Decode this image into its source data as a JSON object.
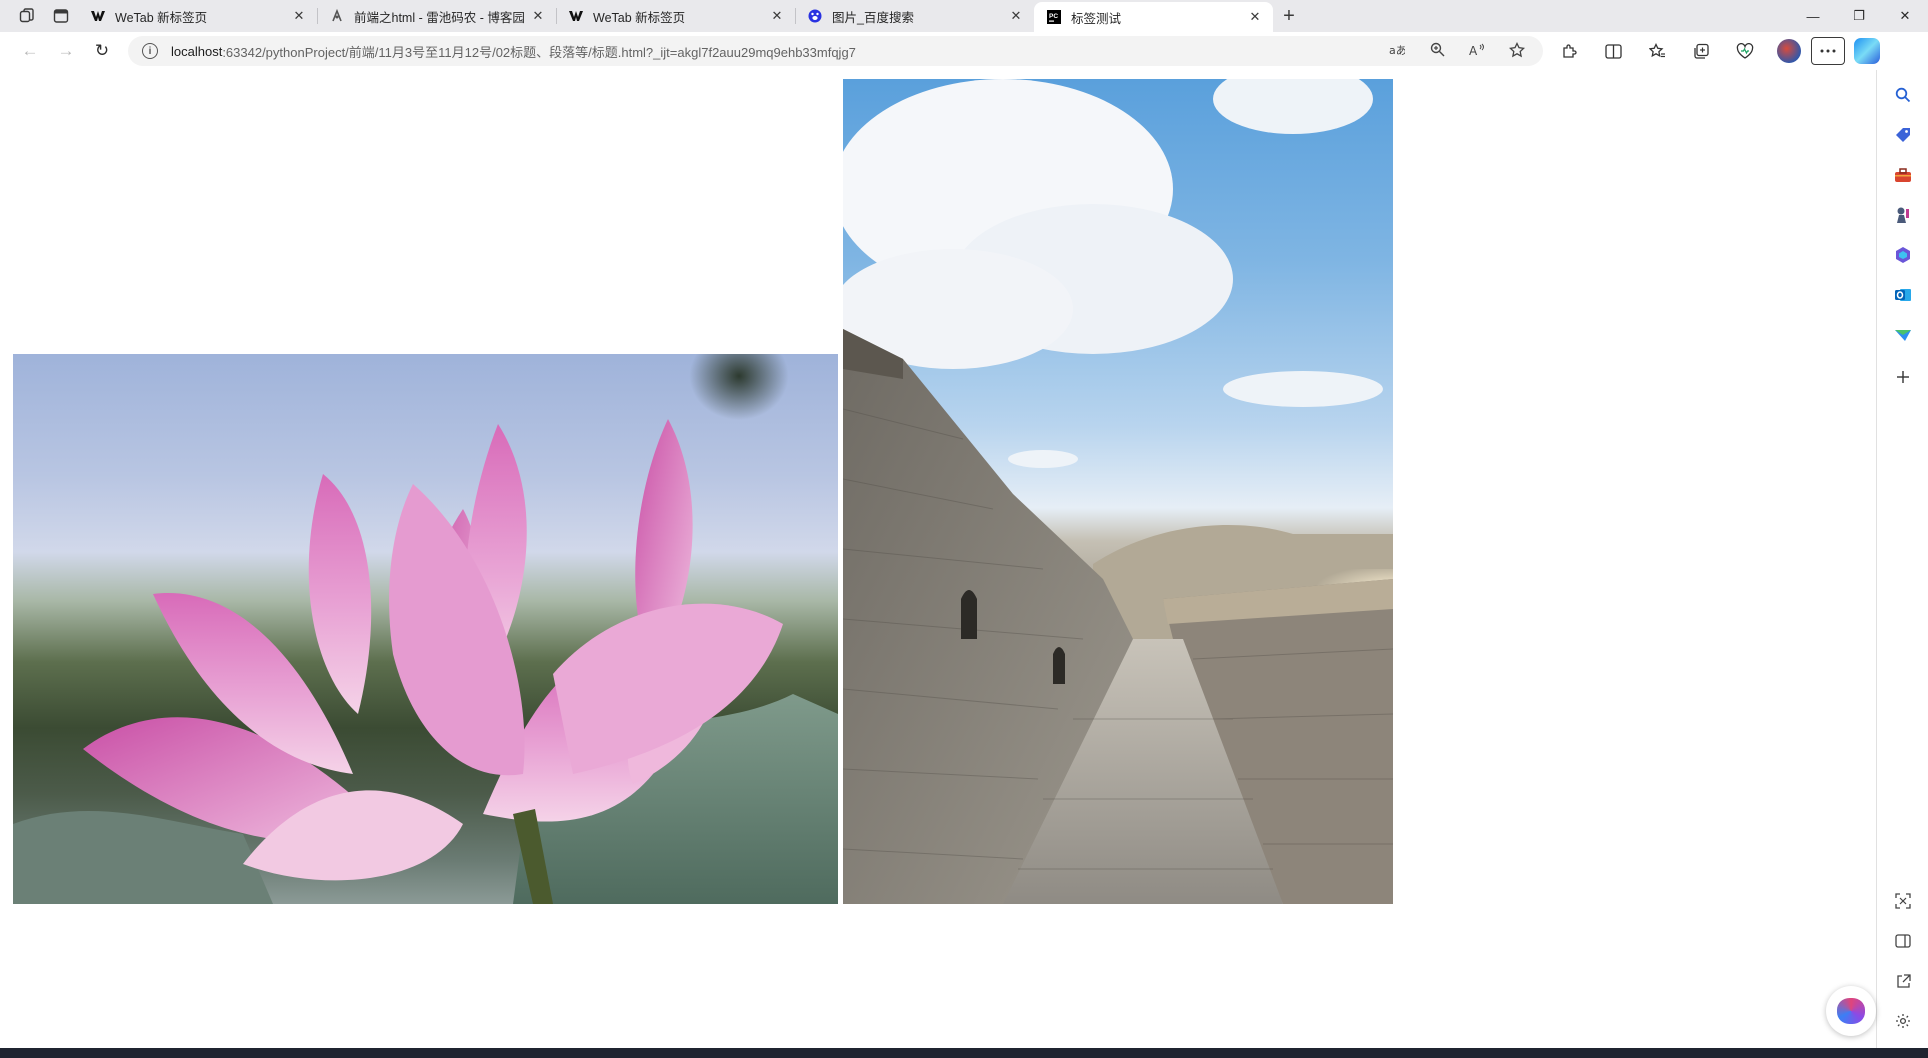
{
  "browser": {
    "tabs": [
      {
        "title": "WeTab 新标签页",
        "icon": "wetab-icon",
        "active": false
      },
      {
        "title": "前端之html - 雷池码农 - 博客园",
        "icon": "cnblogs-icon",
        "active": false
      },
      {
        "title": "WeTab 新标签页",
        "icon": "wetab-icon",
        "active": false
      },
      {
        "title": "图片_百度搜索",
        "icon": "baidu-paw-icon",
        "active": false
      },
      {
        "title": "标签测试",
        "icon": "pycharm-icon",
        "active": true
      }
    ],
    "close_glyph": "✕",
    "new_tab_glyph": "+",
    "window_controls": {
      "minimize": "—",
      "restore": "❐",
      "close": "✕"
    },
    "address": {
      "host": "localhost",
      "path": ":63342/pythonProject/前端/11月3号至11月12号/02标题、段落等/标题.html?_ijt=akgl7f2auu29mq9ehb33mfqjg7"
    },
    "nav": {
      "back": "←",
      "forward": "→",
      "reload": "↻"
    },
    "address_icons": [
      "translate-icon",
      "zoom-icon",
      "read-aloud-icon",
      "favorite-star-icon"
    ],
    "toolbar_icons": [
      "extensions-icon",
      "split-screen-icon",
      "favorites-icon",
      "collections-icon",
      "browser-essentials-icon"
    ]
  },
  "page": {
    "images": [
      {
        "name": "lotus-photo",
        "subject": "pink lotus flower"
      },
      {
        "name": "great-wall-photo",
        "subject": "Great Wall walkway under blue sky"
      }
    ]
  },
  "sidebar": {
    "top_icons": [
      "search-icon",
      "shopping-tag-icon",
      "toolbox-icon",
      "games-icon",
      "microsoft365-icon",
      "outlook-icon",
      "drop-icon",
      "add-icon"
    ],
    "bottom_icons": [
      "screenshot-icon",
      "sidebar-toggle-icon",
      "open-external-icon",
      "settings-icon"
    ]
  },
  "colors": {
    "tabstrip": "#e9e9ec",
    "address_bg": "#f3f3f3",
    "page_bg": "#ffffff"
  }
}
